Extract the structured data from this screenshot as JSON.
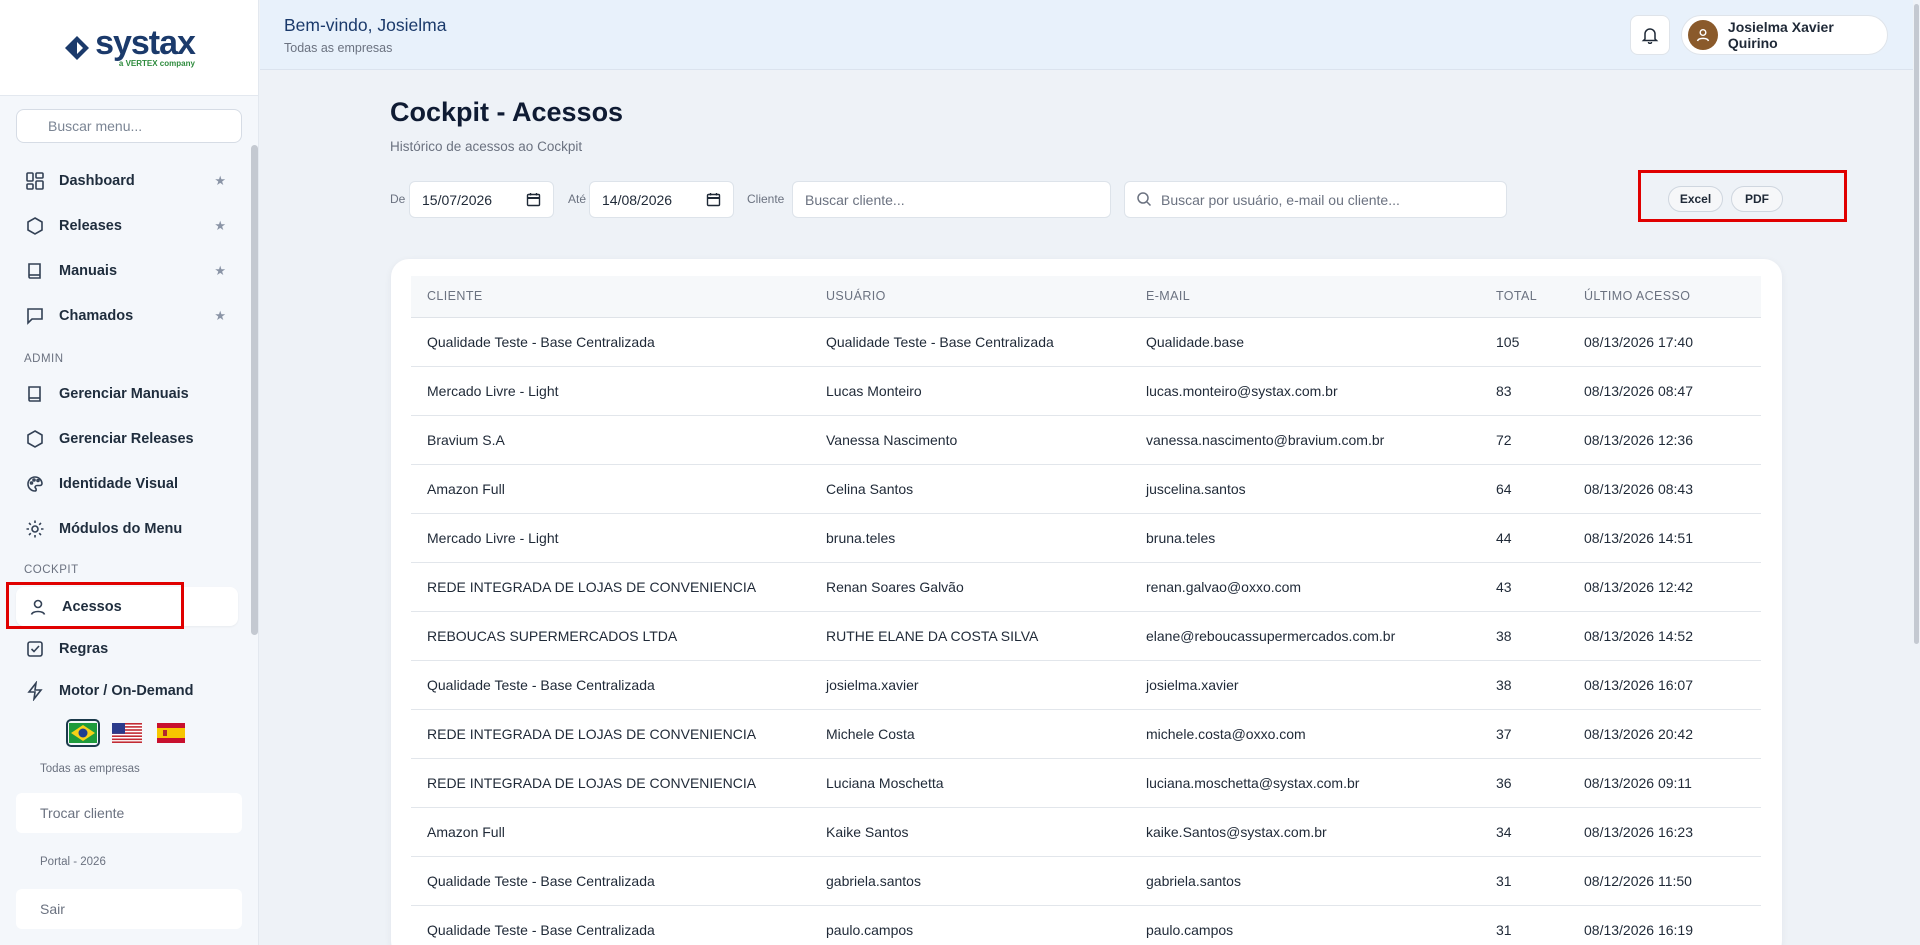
{
  "sidebar": {
    "logo_text": "systax",
    "logo_sub": "a VERTEX company",
    "search_placeholder": "Buscar menu...",
    "items": [
      {
        "label": "Dashboard",
        "icon": "dashboard-icon",
        "starred": true
      },
      {
        "label": "Releases",
        "icon": "hexagon-icon",
        "starred": true
      },
      {
        "label": "Manuais",
        "icon": "book-icon",
        "starred": true
      },
      {
        "label": "Chamados",
        "icon": "chat-icon",
        "starred": true
      }
    ],
    "admin_label": "ADMIN",
    "admin_items": [
      {
        "label": "Gerenciar Manuais",
        "icon": "book-icon"
      },
      {
        "label": "Gerenciar Releases",
        "icon": "hexagon-icon"
      },
      {
        "label": "Identidade Visual",
        "icon": "palette-icon"
      },
      {
        "label": "Módulos do Menu",
        "icon": "gear-icon"
      }
    ],
    "cockpit_label": "COCKPIT",
    "cockpit_items": [
      {
        "label": "Acessos",
        "icon": "user-icon",
        "active": true
      },
      {
        "label": "Regras",
        "icon": "checkbox-icon"
      },
      {
        "label": "Motor / On-Demand",
        "icon": "lightning-icon"
      }
    ],
    "star_glyph": "★",
    "languages": [
      "pt-BR",
      "en-US",
      "es-ES"
    ],
    "company_scope": "Todas as empresas",
    "switch_client": "Trocar cliente",
    "version": "Portal - 2026",
    "logout": "Sair"
  },
  "header": {
    "welcome": "Bem-vindo, Josielma",
    "subtitle": "Todas as empresas",
    "user_name": "Josielma Xavier Quirino"
  },
  "page": {
    "title": "Cockpit - Acessos",
    "subtitle": "Histórico de acessos ao Cockpit"
  },
  "filters": {
    "from_label": "De",
    "from_value": "15/07/2026",
    "to_label": "Até",
    "to_value": "14/08/2026",
    "client_label": "Cliente",
    "client_placeholder": "Buscar cliente...",
    "search_placeholder": "Buscar por usuário, e-mail ou cliente...",
    "excel_label": "Excel",
    "pdf_label": "PDF"
  },
  "table": {
    "headers": [
      "CLIENTE",
      "USUÁRIO",
      "E-MAIL",
      "TOTAL",
      "ÚLTIMO ACESSO"
    ],
    "rows": [
      [
        "Qualidade Teste - Base Centralizada",
        "Qualidade Teste - Base Centralizada",
        "Qualidade.base",
        "105",
        "08/13/2026 17:40"
      ],
      [
        "Mercado Livre - Light",
        "Lucas Monteiro",
        "lucas.monteiro@systax.com.br",
        "83",
        "08/13/2026 08:47"
      ],
      [
        "Bravium S.A",
        "Vanessa Nascimento",
        "vanessa.nascimento@bravium.com.br",
        "72",
        "08/13/2026 12:36"
      ],
      [
        "Amazon Full",
        "Celina Santos",
        "juscelina.santos",
        "64",
        "08/13/2026 08:43"
      ],
      [
        "Mercado Livre - Light",
        "bruna.teles",
        "bruna.teles",
        "44",
        "08/13/2026 14:51"
      ],
      [
        "REDE INTEGRADA DE LOJAS DE CONVENIENCIA",
        "Renan Soares Galvão",
        "renan.galvao@oxxo.com",
        "43",
        "08/13/2026 12:42"
      ],
      [
        "REBOUCAS SUPERMERCADOS LTDA",
        "RUTHE ELANE DA COSTA SILVA",
        "elane@reboucassupermercados.com.br",
        "38",
        "08/13/2026 14:52"
      ],
      [
        "Qualidade Teste - Base Centralizada",
        "josielma.xavier",
        "josielma.xavier",
        "38",
        "08/13/2026 16:07"
      ],
      [
        "REDE INTEGRADA DE LOJAS DE CONVENIENCIA",
        "Michele Costa",
        "michele.costa@oxxo.com",
        "37",
        "08/13/2026 20:42"
      ],
      [
        "REDE INTEGRADA DE LOJAS DE CONVENIENCIA",
        "Luciana Moschetta",
        "luciana.moschetta@systax.com.br",
        "36",
        "08/13/2026 09:11"
      ],
      [
        "Amazon Full",
        "Kaike Santos",
        "kaike.Santos@systax.com.br",
        "34",
        "08/13/2026 16:23"
      ],
      [
        "Qualidade Teste - Base Centralizada",
        "gabriela.santos",
        "gabriela.santos",
        "31",
        "08/12/2026 11:50"
      ],
      [
        "Qualidade Teste - Base Centralizada",
        "paulo.campos",
        "paulo.campos",
        "31",
        "08/13/2026 16:19"
      ]
    ]
  },
  "colors": {
    "brand_navy": "#1b3a6b",
    "brand_green": "#2e8b3d",
    "highlight_red": "#e00000"
  }
}
